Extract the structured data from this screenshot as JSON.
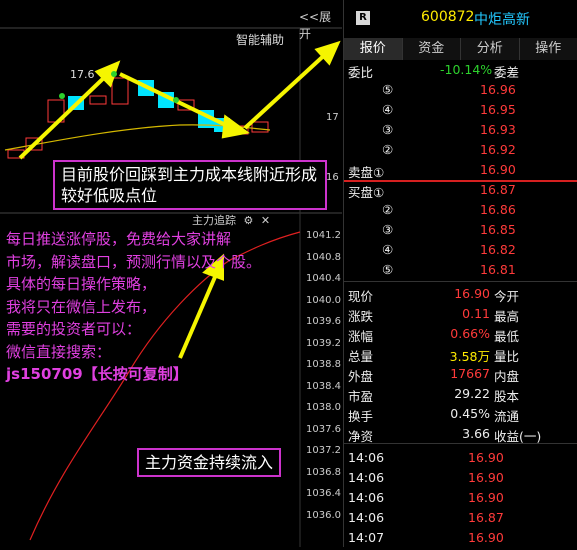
{
  "stock": {
    "code": "600872",
    "name": "中炬高新",
    "badge": "R"
  },
  "header": {
    "expand_label": "<<展开"
  },
  "chart": {
    "smart_assist": "智能辅助",
    "hi_label": "17.6",
    "price_axis_label": "17",
    "price_axis_label2": "16",
    "tracker_title": "主力追踪",
    "tracker_icons": [
      "gear-icon",
      "close-icon"
    ],
    "yticks": [
      "1041.2",
      "1040.8",
      "1040.4",
      "1040.0",
      "1039.6",
      "1039.2",
      "1038.8",
      "1038.4",
      "1038.0",
      "1037.6",
      "1037.2",
      "1036.8",
      "1036.4",
      "1036.0"
    ],
    "colors": {
      "up": "#ff3a3a",
      "down": "#00e5ff",
      "ma": "#d4b800",
      "annotation_arrow": "#f5f500",
      "box_border": "#cc33cc"
    }
  },
  "annotations": {
    "top": "目前股价回踩到主力成本线附近形成较好低吸点位",
    "bottom": "主力资金持续流入"
  },
  "promo": {
    "lines": [
      "每日推送涨停股，免费给大家讲解",
      "市场，解读盘口，预测行情以及个股。",
      "具体的每日操作策略，",
      "我将只在微信上发布，",
      "需要的投资者可以：",
      "微信直接搜索：",
      "js150709【长按可复制】"
    ]
  },
  "tabs": [
    "报价",
    "资金",
    "分析",
    "操作"
  ],
  "commission": {
    "label": "委比",
    "value": "-10.14%",
    "label2": "委差"
  },
  "sell": [
    {
      "label": "⑤",
      "price": "16.96"
    },
    {
      "label": "④",
      "price": "16.95"
    },
    {
      "label": "③",
      "price": "16.93"
    },
    {
      "label": "②",
      "price": "16.92"
    },
    {
      "label": "卖盘①",
      "price": "16.90"
    }
  ],
  "buy": [
    {
      "label": "买盘①",
      "price": "16.87"
    },
    {
      "label": "②",
      "price": "16.86"
    },
    {
      "label": "③",
      "price": "16.85"
    },
    {
      "label": "④",
      "price": "16.82"
    },
    {
      "label": "⑤",
      "price": "16.81"
    }
  ],
  "stats": [
    {
      "l": "现价",
      "v": "16.90",
      "r": "今开",
      "vc": "red"
    },
    {
      "l": "涨跌",
      "v": "0.11",
      "r": "最高",
      "vc": "red"
    },
    {
      "l": "涨幅",
      "v": "0.66%",
      "r": "最低",
      "vc": "red"
    },
    {
      "l": "总量",
      "v": "3.58万",
      "r": "量比",
      "vc": "yellow"
    },
    {
      "l": "外盘",
      "v": "17667",
      "r": "内盘",
      "vc": "red"
    },
    {
      "l": "市盈",
      "v": "29.22",
      "r": "股本",
      "vc": "white"
    },
    {
      "l": "换手",
      "v": "0.45%",
      "r": "流通",
      "vc": "white"
    },
    {
      "l": "净资",
      "v": "3.66",
      "r": "收益(一)",
      "vc": "white"
    }
  ],
  "ticks": [
    {
      "t": "14:06",
      "p": "16.90"
    },
    {
      "t": "14:06",
      "p": "16.90"
    },
    {
      "t": "14:06",
      "p": "16.90"
    },
    {
      "t": "14:06",
      "p": "16.87"
    },
    {
      "t": "14:07",
      "p": "16.90"
    }
  ]
}
